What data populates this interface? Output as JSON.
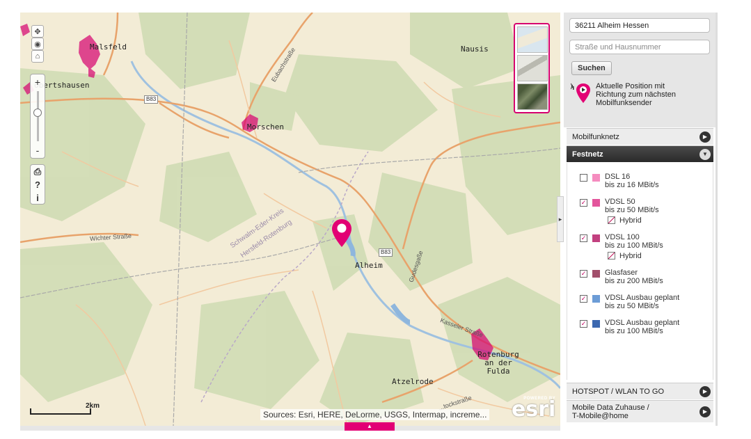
{
  "map": {
    "places": {
      "malsfeld": "Malsfeld",
      "obertshausen": "obertshausen",
      "morschen": "Morschen",
      "nausis": "Nausis",
      "alheim": "Alheim",
      "rotenburg": "Rotenburg\nan der\nFulda",
      "atzelrode": "Atzelrode"
    },
    "roads": {
      "b83_top": "B83",
      "b83_mid": "B83",
      "wichter": "Wichter Straße",
      "eubach": "Eubachstraße",
      "gudeg": "Gudesgaße",
      "kasseler": "Kasseler Straße",
      "stocks": "...tockstraße",
      "kreis1": "Schwalm-Eder-Kreis",
      "kreis2": "Hersfeld-Rotenburg"
    },
    "scale_label": "2km",
    "attribution": "Sources: Esri, HERE, DeLorme, USGS, Intermap, increme...",
    "powered_by": "POWERED BY",
    "esri_logo": "esri",
    "controls": {
      "zoom_in": "+",
      "zoom_out": "-",
      "print": "⎙",
      "help": "?",
      "info": "i"
    },
    "colors": {
      "coverage": "#d6006f",
      "road": "#e8a36b",
      "forest": "#cfdcb4"
    }
  },
  "panel": {
    "location_value": "36211 Alheim Hessen",
    "street_placeholder": "Straße und Hausnummer",
    "search_label": "Suchen",
    "locate_text": "Aktuelle Position mit\nRichtung zum nächsten\nMobilfunksender",
    "sections": {
      "mobilfunknetz": "Mobilfunknetz",
      "festnetz": "Festnetz",
      "hotspot": "HOTSPOT / WLAN TO GO",
      "mobile_data": "Mobile Data Zuhause /\nT-Mobile@home"
    },
    "legend": [
      {
        "name": "DSL 16",
        "sub": "bis zu 16 MBit/s",
        "checked": false,
        "color": "#f58cbf",
        "hybrid": false
      },
      {
        "name": "VDSL 50",
        "sub": "bis zu 50 MBit/s",
        "checked": true,
        "color": "#e3559c",
        "hybrid": true
      },
      {
        "name": "VDSL 100",
        "sub": "bis zu 100 MBit/s",
        "checked": true,
        "color": "#c2407f",
        "hybrid": true
      },
      {
        "name": "Glasfaser",
        "sub": "bis zu 200 MBit/s",
        "checked": true,
        "color": "#a24f6b",
        "hybrid": false
      },
      {
        "name": "VDSL Ausbau geplant",
        "sub": "bis zu 50 MBit/s",
        "checked": true,
        "color": "#6c9cd6",
        "hybrid": false
      },
      {
        "name": "VDSL Ausbau geplant",
        "sub": "bis zu 100 MBit/s",
        "checked": true,
        "color": "#3c68b0",
        "hybrid": false
      }
    ],
    "hybrid_label": "Hybrid"
  }
}
